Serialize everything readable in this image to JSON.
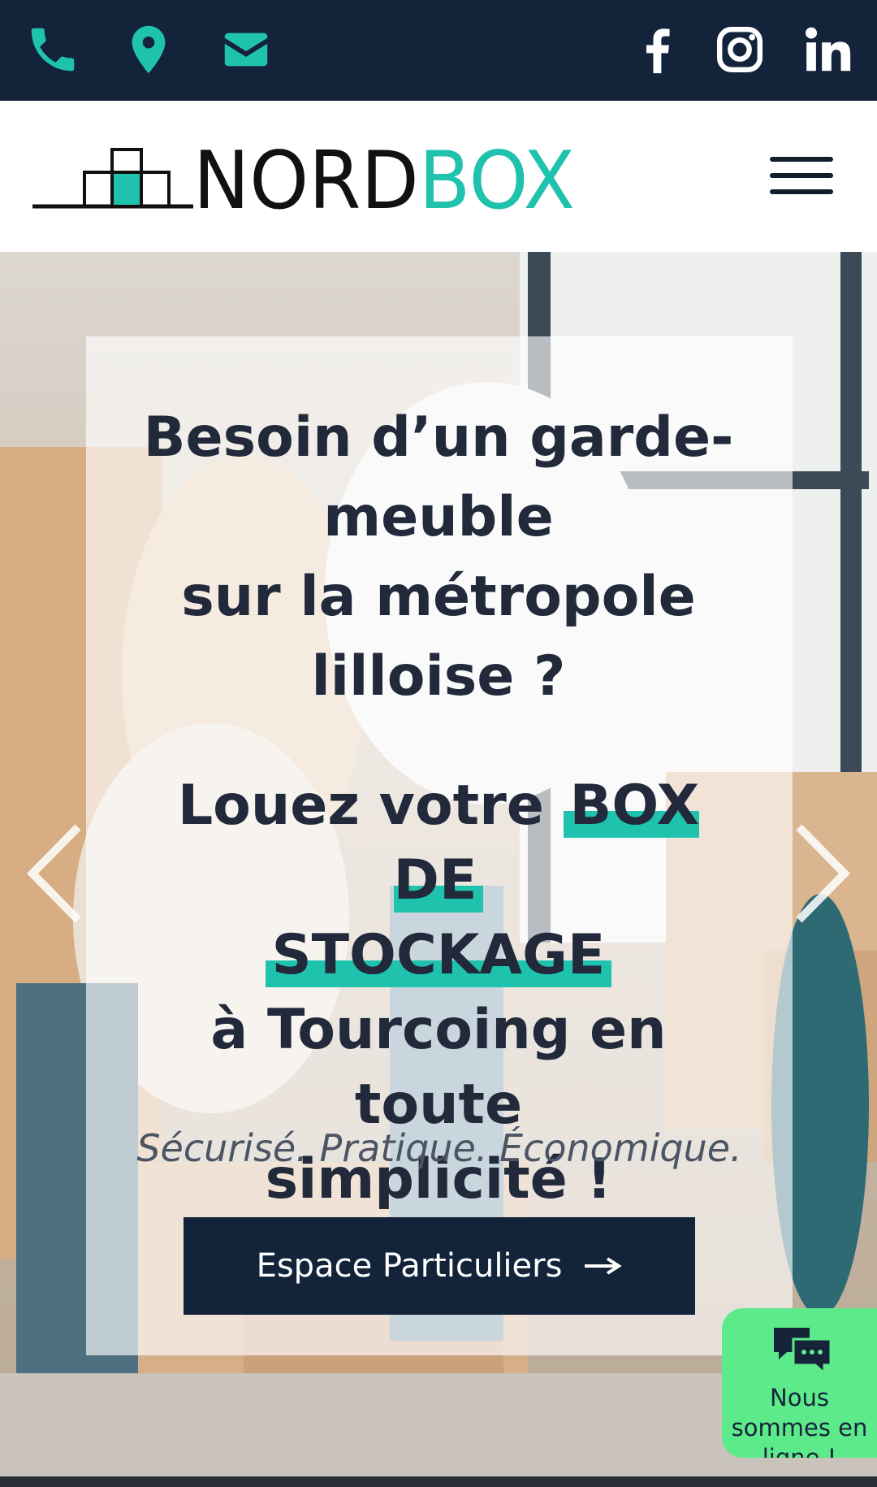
{
  "colors": {
    "navy": "#12233a",
    "teal": "#1fc2ad",
    "text_dark": "#22293a",
    "chat_green": "#5cea8a"
  },
  "topbar": {
    "left_icons": [
      "phone-icon",
      "map-pin-icon",
      "envelope-icon"
    ],
    "right_icons": [
      "facebook-icon",
      "instagram-icon",
      "linkedin-icon"
    ]
  },
  "header": {
    "logo": {
      "part1": "NORD",
      "part2": "BOX"
    },
    "menu_icon": "hamburger-menu-icon"
  },
  "hero": {
    "headline1": [
      "Besoin d’un garde-",
      "meuble",
      "sur la métropole",
      "lilloise ?"
    ],
    "headline2_prefix": "Louez votre ",
    "highlight_line1": "BOX DE",
    "highlight_line2": "STOCKAGE",
    "headline2_rest": [
      "à Tourcoing en toute",
      "simplicité !"
    ],
    "tagline": "Sécurisé. Pratique. Économique.",
    "cta_label": "Espace Particuliers",
    "prev_icon": "chevron-left-icon",
    "next_icon": "chevron-right-icon"
  },
  "chat": {
    "icon": "chat-bubbles-icon",
    "line1": "Nous",
    "line2": "sommes en",
    "line3": "ligne !"
  }
}
